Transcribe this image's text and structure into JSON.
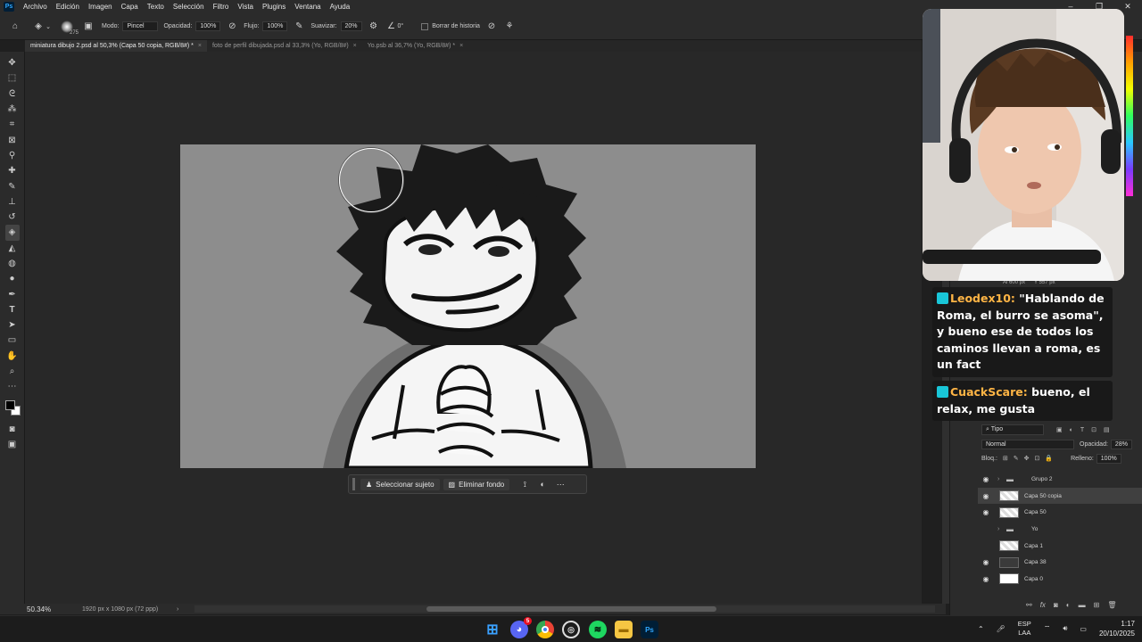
{
  "app": {
    "logo": "Ps",
    "menu": [
      "Archivo",
      "Edición",
      "Imagen",
      "Capa",
      "Texto",
      "Selección",
      "Filtro",
      "Vista",
      "Plugins",
      "Ventana",
      "Ayuda"
    ]
  },
  "options": {
    "brush_size": "275",
    "mode_label": "Modo:",
    "mode_value": "Pincel",
    "opacity_label": "Opacidad:",
    "opacity_value": "100%",
    "flow_label": "Flujo:",
    "flow_value": "100%",
    "smoothing_label": "Suavizar:",
    "smoothing_value": "20%",
    "angle_value": "0°",
    "erase_history_label": "Borrar de historia"
  },
  "tabs": [
    {
      "label": "miniatura dibujo 2.psd al 50,3% (Capa 50 copia, RGB/8#) *"
    },
    {
      "label": "foto de perfil dibujada.psd al 33,3% (Yo, RGB/8#)"
    },
    {
      "label": "Yo.psb al 36,7% (Yo, RGB/8#) *"
    }
  ],
  "tools": [
    "move",
    "marquee",
    "lasso",
    "magic-wand",
    "crop",
    "frame",
    "eyedropper",
    "healing",
    "brush",
    "stamp",
    "history-brush",
    "eraser",
    "bucket",
    "blur",
    "dodge",
    "pen",
    "type",
    "path-select",
    "rectangle",
    "hand",
    "zoom",
    "more"
  ],
  "context_bar": {
    "select_subject": "Seleccionar sujeto",
    "remove_bg": "Eliminar fondo"
  },
  "status": {
    "zoom": "50.34%",
    "doc_info": "1920 px x 1080 px (72 ppp)"
  },
  "properties": {
    "w": "Al 600 px",
    "h": "Y 557 px"
  },
  "layers_panel": {
    "filter": "Tipo",
    "blend_mode": "Normal",
    "opacity_label": "Opacidad:",
    "opacity_value": "28%",
    "lock_label": "Bloq.:",
    "fill_label": "Relleno:",
    "fill_value": "100%",
    "layers": [
      {
        "name": "Grupo 2",
        "type": "group",
        "visible": true,
        "selected": false
      },
      {
        "name": "Capa 50 copia",
        "type": "checker",
        "visible": true,
        "selected": true
      },
      {
        "name": "Capa 50",
        "type": "checker",
        "visible": true,
        "selected": false
      },
      {
        "name": "Yo",
        "type": "group",
        "visible": false,
        "selected": false
      },
      {
        "name": "Capa 1",
        "type": "checker",
        "visible": false,
        "selected": false
      },
      {
        "name": "Capa 38",
        "type": "dark",
        "visible": true,
        "selected": false
      },
      {
        "name": "Capa 0",
        "type": "white",
        "visible": true,
        "selected": false
      }
    ]
  },
  "chat": [
    {
      "user": "Leodex10:",
      "text": " \"Hablando de Roma, el burro se asoma\", y bueno ese de todos los caminos llevan a roma, es un fact"
    },
    {
      "user": "CuackScare:",
      "text": " bueno, el relax, me gusta"
    }
  ],
  "system": {
    "lang_line1": "ESP",
    "lang_line2": "LAA",
    "time": "1:17",
    "date": "20/10/2025",
    "discord_badge": "5"
  },
  "colors": {
    "accent": "#31a8ff",
    "chat_username": "#ffb545",
    "chat_badge": "#19c6d8"
  }
}
